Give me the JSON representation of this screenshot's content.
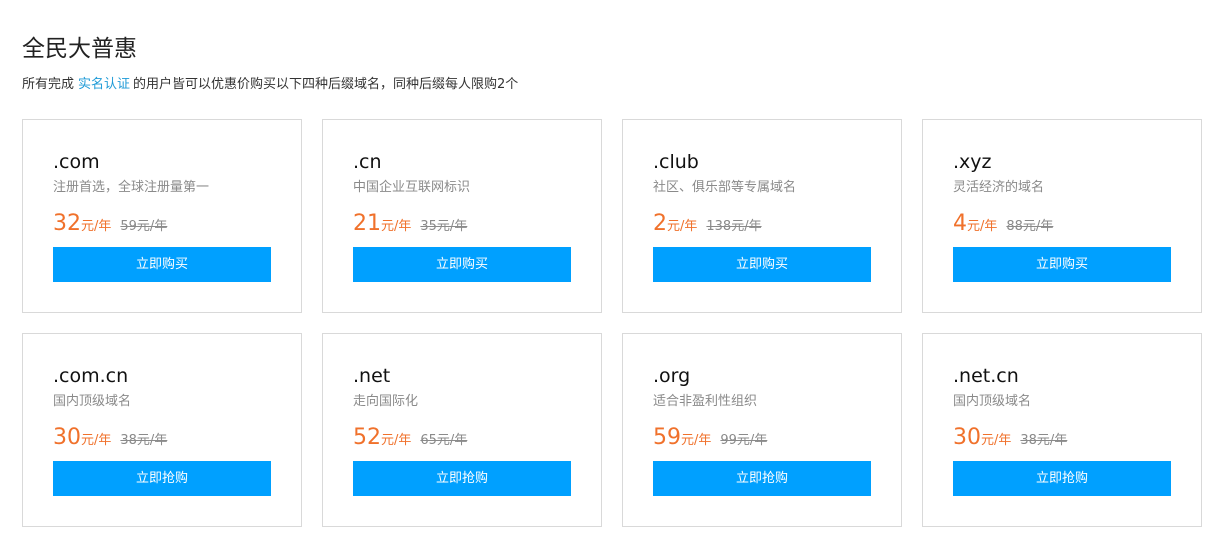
{
  "page": {
    "title": "全民大普惠",
    "desc_before": "所有完成",
    "desc_link": "实名认证",
    "desc_after": "的用户皆可以优惠价购买以下四种后缀域名，同种后缀每人限购2个",
    "link_color": "#1f9bd7",
    "accent_color": "#f0712b",
    "button_color": "#00a0ff"
  },
  "cards": [
    {
      "suffix": ".com",
      "desc": "注册首选，全球注册量第一",
      "price": "32",
      "unit": "元/年",
      "original": "59元/年",
      "button": "立即购买"
    },
    {
      "suffix": ".cn",
      "desc": "中国企业互联网标识",
      "price": "21",
      "unit": "元/年",
      "original": "35元/年",
      "button": "立即购买"
    },
    {
      "suffix": ".club",
      "desc": "社区、俱乐部等专属域名",
      "price": "2",
      "unit": "元/年",
      "original": "138元/年",
      "button": "立即购买"
    },
    {
      "suffix": ".xyz",
      "desc": "灵活经济的域名",
      "price": "4",
      "unit": "元/年",
      "original": "88元/年",
      "button": "立即购买"
    },
    {
      "suffix": ".com.cn",
      "desc": "国内顶级域名",
      "price": "30",
      "unit": "元/年",
      "original": "38元/年",
      "button": "立即抢购"
    },
    {
      "suffix": ".net",
      "desc": "走向国际化",
      "price": "52",
      "unit": "元/年",
      "original": "65元/年",
      "button": "立即抢购"
    },
    {
      "suffix": ".org",
      "desc": "适合非盈利性组织",
      "price": "59",
      "unit": "元/年",
      "original": "99元/年",
      "button": "立即抢购"
    },
    {
      "suffix": ".net.cn",
      "desc": "国内顶级域名",
      "price": "30",
      "unit": "元/年",
      "original": "38元/年",
      "button": "立即抢购"
    }
  ]
}
